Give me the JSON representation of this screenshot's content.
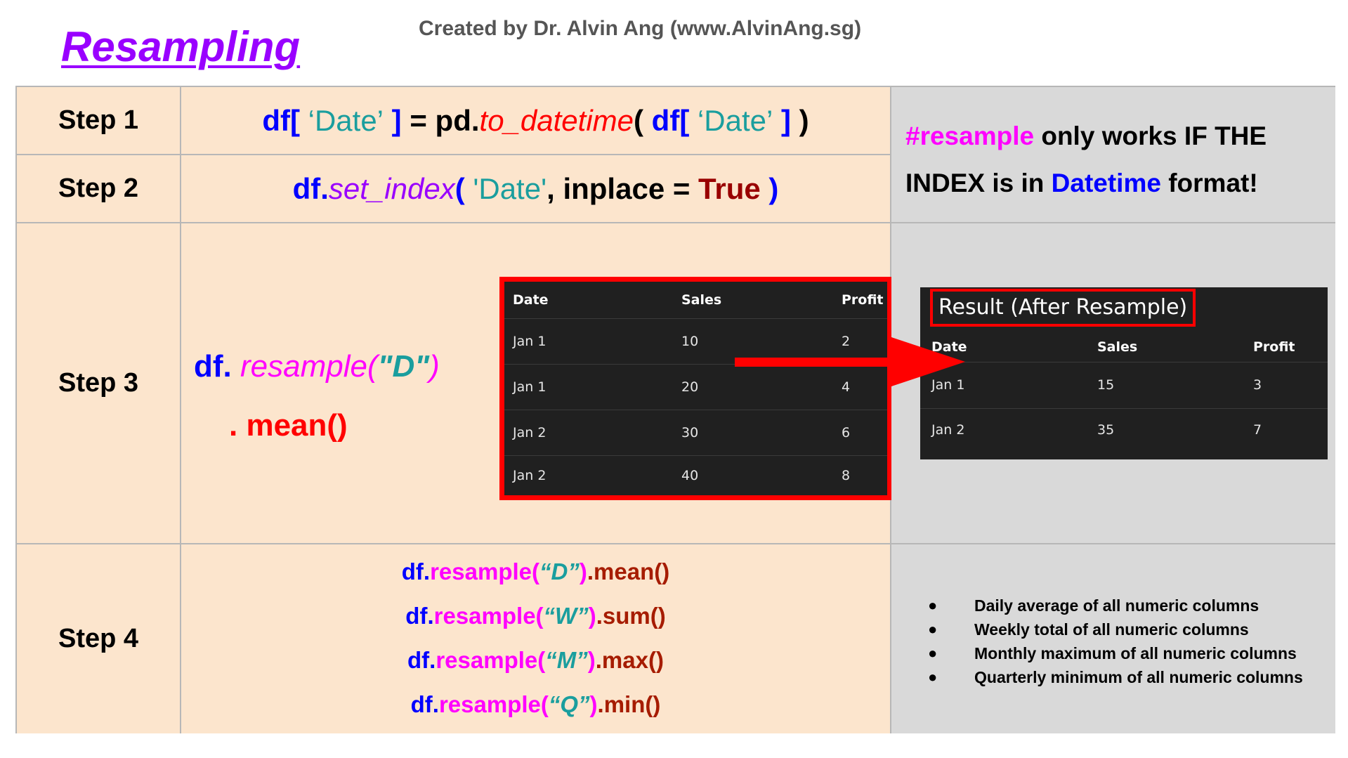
{
  "title": "Resampling",
  "credit": "Created by Dr. Alvin Ang (www.AlvinAng.sg)",
  "steps": {
    "step1": {
      "label": "Step 1",
      "code": [
        "df[ ",
        "‘Date’",
        " ]",
        " = pd.",
        "to_datetime",
        "( ",
        "df[ ",
        "‘Date’",
        " ]",
        " )"
      ]
    },
    "step2": {
      "label": "Step 2",
      "code": [
        "df.",
        "set_index",
        "( ",
        "'Date'",
        ", inplace = ",
        "True",
        " )"
      ]
    },
    "step3": {
      "label": "Step 3",
      "code_line1": [
        "df. ",
        "resample(",
        "\"D\"",
        ")"
      ],
      "code_line2": ". mean()"
    },
    "step4": {
      "label": "Step 4",
      "lines": [
        {
          "prefix": "df.",
          "fn": "resample(",
          "arg": "“D”",
          "close": ")",
          "agg": ".mean()"
        },
        {
          "prefix": "df.",
          "fn": "resample(",
          "arg": "“W”",
          "close": ")",
          "agg": ".sum()"
        },
        {
          "prefix": "df.",
          "fn": "resample(",
          "arg": "“M”",
          "close": ")",
          "agg": ".max()"
        },
        {
          "prefix": "df.",
          "fn": "resample(",
          "arg": "“Q”",
          "close": ")",
          "agg": ".min()"
        }
      ]
    }
  },
  "note": {
    "part1": "#resample",
    "part2": " only works IF THE INDEX is in ",
    "part3": "Datetime",
    "part4": " format!"
  },
  "input_table": {
    "headers": [
      "Date",
      "Sales",
      "Profit"
    ],
    "rows": [
      [
        "Jan 1",
        "10",
        "2"
      ],
      [
        "Jan 1",
        "20",
        "4"
      ],
      [
        "Jan 2",
        "30",
        "6"
      ],
      [
        "Jan 2",
        "40",
        "8"
      ]
    ]
  },
  "result_table": {
    "title": "Result (After Resample)",
    "headers": [
      "Date",
      "Sales",
      "Profit"
    ],
    "rows": [
      [
        "Jan 1",
        "15",
        "3"
      ],
      [
        "Jan 2",
        "35",
        "7"
      ]
    ]
  },
  "step4_notes": [
    "Daily average of all numeric columns",
    "Weekly total of all numeric columns",
    "Monthly maximum of all numeric columns",
    "Quarterly minimum of all numeric columns"
  ],
  "bullet_glyph": "●",
  "colors": {
    "title": "#9900ff",
    "peach": "#fce5cd",
    "gray": "#d9d9d9",
    "code_blue": "#0000ff",
    "highlight_red": "#ff0000",
    "magenta": "#ff00ff"
  }
}
